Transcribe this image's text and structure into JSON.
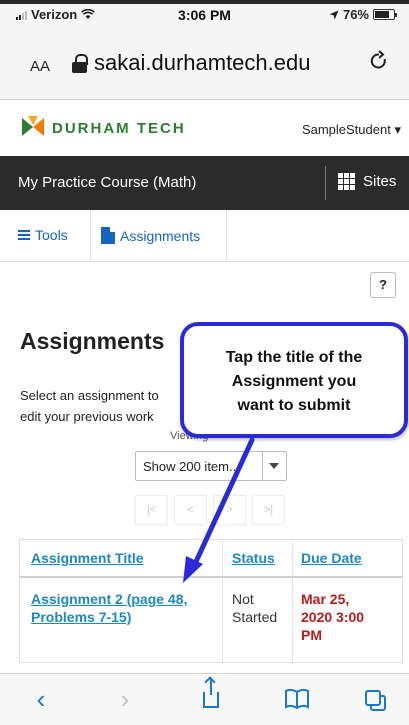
{
  "status_bar": {
    "carrier": "Verizon",
    "time": "3:06 PM",
    "battery": "76%",
    "battery_level": 0.76
  },
  "browser": {
    "text_size_label": "AA",
    "url": "sakai.durhamtech.edu"
  },
  "header": {
    "logo_word1": "DURHAM",
    "logo_word2": "TECH",
    "user_name": "SampleStudent",
    "user_caret": "▾"
  },
  "course_bar": {
    "course_title": "My Practice Course (Math)",
    "sites_label": "Sites"
  },
  "tools_bar": {
    "tools_label": "Tools",
    "assignments_label": "Assignments"
  },
  "page": {
    "help_label": "?",
    "title": "Assignments",
    "instruction_line1": "Select an assignment to",
    "instruction_line2": "edit your previous work",
    "viewing_label": "Viewing",
    "page_size_value": "Show 200 item...",
    "pager": {
      "first": "|<",
      "prev": "<",
      "next": ">",
      "last": ">|"
    }
  },
  "table": {
    "headers": {
      "title": "Assignment Title",
      "status": "Status",
      "due": "Due Date"
    },
    "rows": [
      {
        "title_line1": "Assignment 2 (page 48,",
        "title_line2": "Problems 7-15)",
        "status_line1": "Not",
        "status_line2": "Started",
        "due_line1": "Mar 25,",
        "due_line2": "2020 3:00",
        "due_line3": "PM"
      }
    ]
  },
  "callout": {
    "line1": "Tap the title of the",
    "line2": "Assignment you",
    "line3": "want to submit"
  },
  "bottom_bar": {
    "back": "‹",
    "forward": "›",
    "bookmarks": "🕮"
  },
  "colors": {
    "link": "#1e88c7",
    "due_date": "#b71c1c",
    "callout_border": "#2a2ad9",
    "course_bar": "#2b2b2b",
    "ios_blue": "#1976d2",
    "logo_green": "#2e7d32",
    "logo_orange": "#f57c00"
  }
}
